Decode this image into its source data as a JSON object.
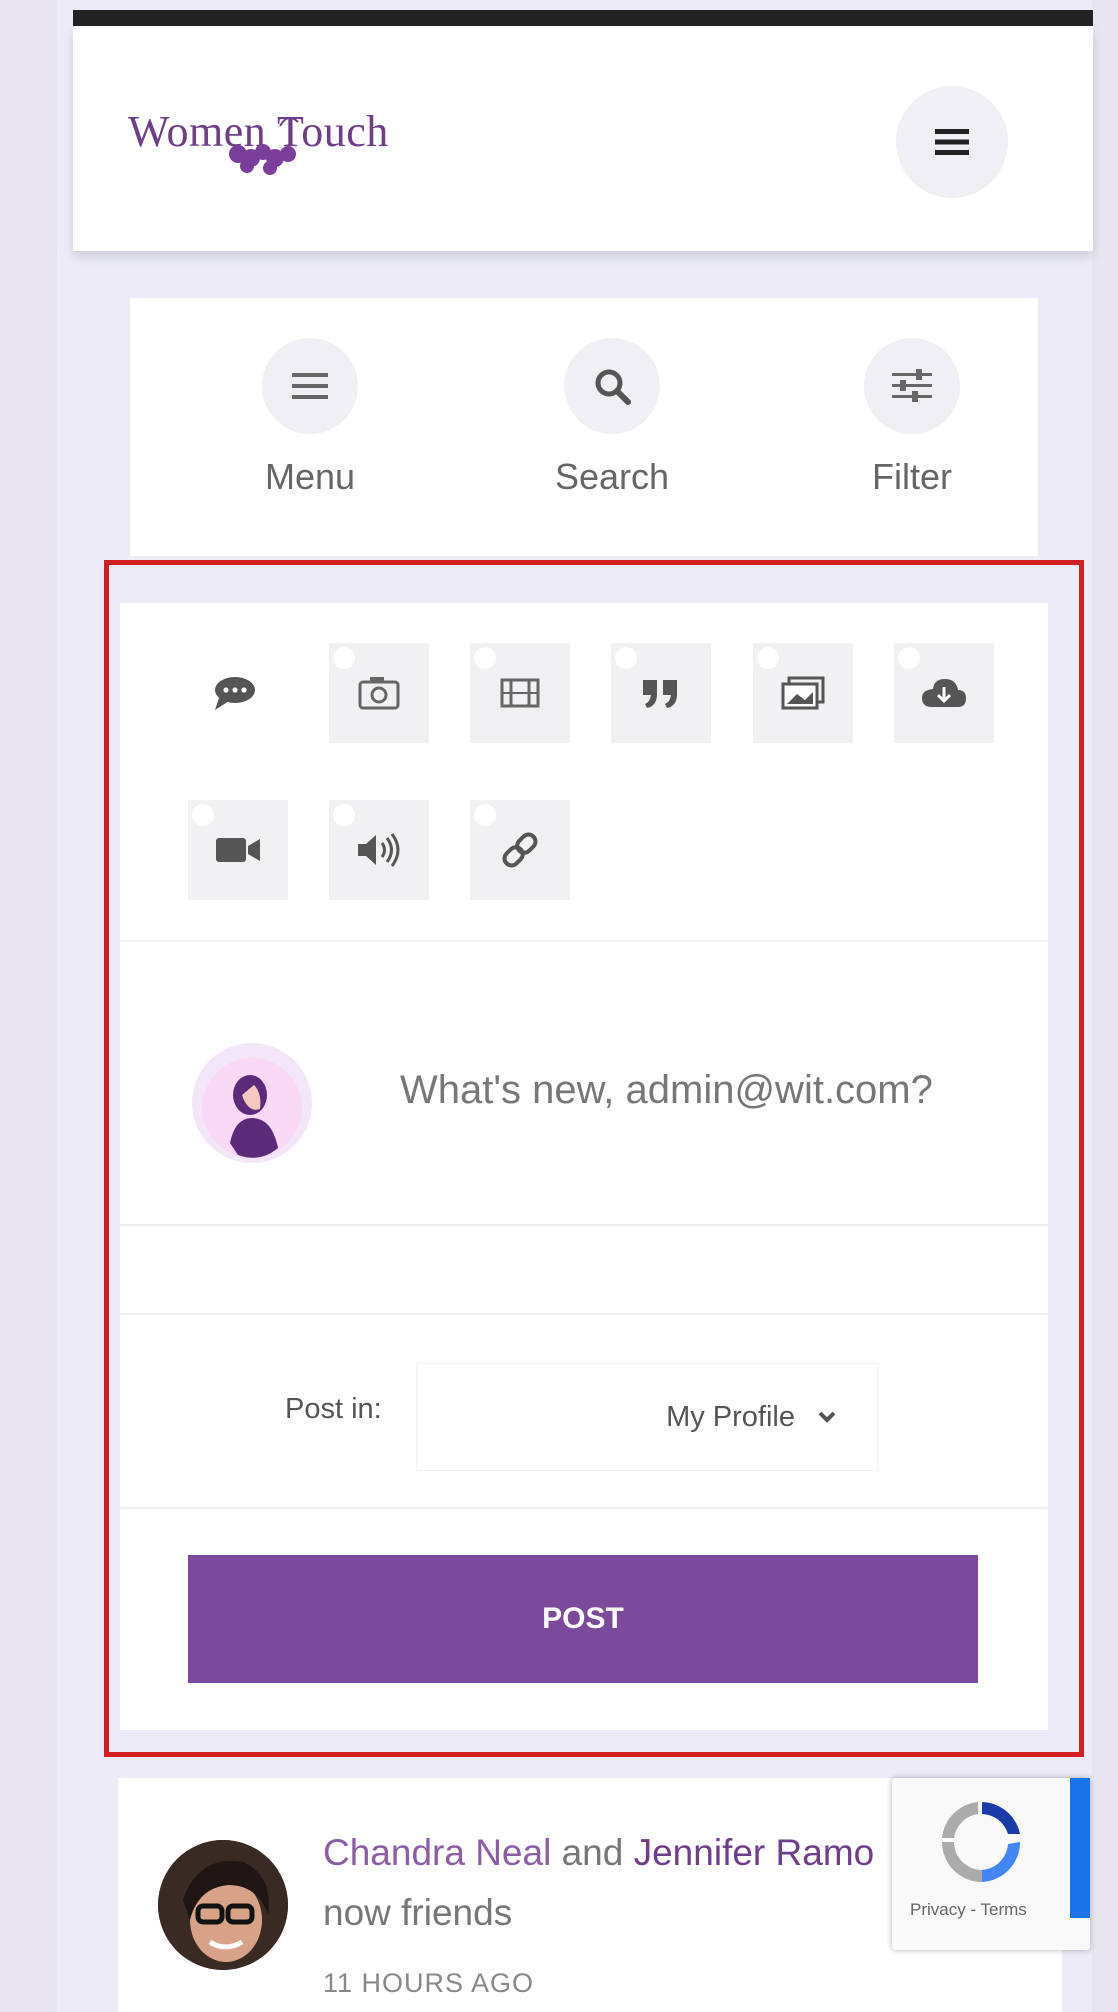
{
  "header": {
    "logo_text": "Women Touch"
  },
  "tools": {
    "menu_label": "Menu",
    "search_label": "Search",
    "filter_label": "Filter"
  },
  "composer": {
    "post_types": [
      "status-icon",
      "photo-icon",
      "video-icon",
      "quote-icon",
      "gallery-icon",
      "upload-icon",
      "video-camera-icon",
      "audio-icon",
      "link-icon"
    ],
    "placeholder": "What's new, admin@wit.com?",
    "post_in_label": "Post in:",
    "post_in_value": "My Profile",
    "post_button": "POST"
  },
  "activity": {
    "actor": "Chandra Neal",
    "joiner": "and",
    "friend": "Jennifer Ramo",
    "suffix": "now friends",
    "time": "11 HOURS AGO"
  },
  "recaptcha": {
    "text": "Privacy - Terms"
  },
  "colors": {
    "brand_purple": "#7b4a9a",
    "highlight_red": "#d21f24"
  }
}
